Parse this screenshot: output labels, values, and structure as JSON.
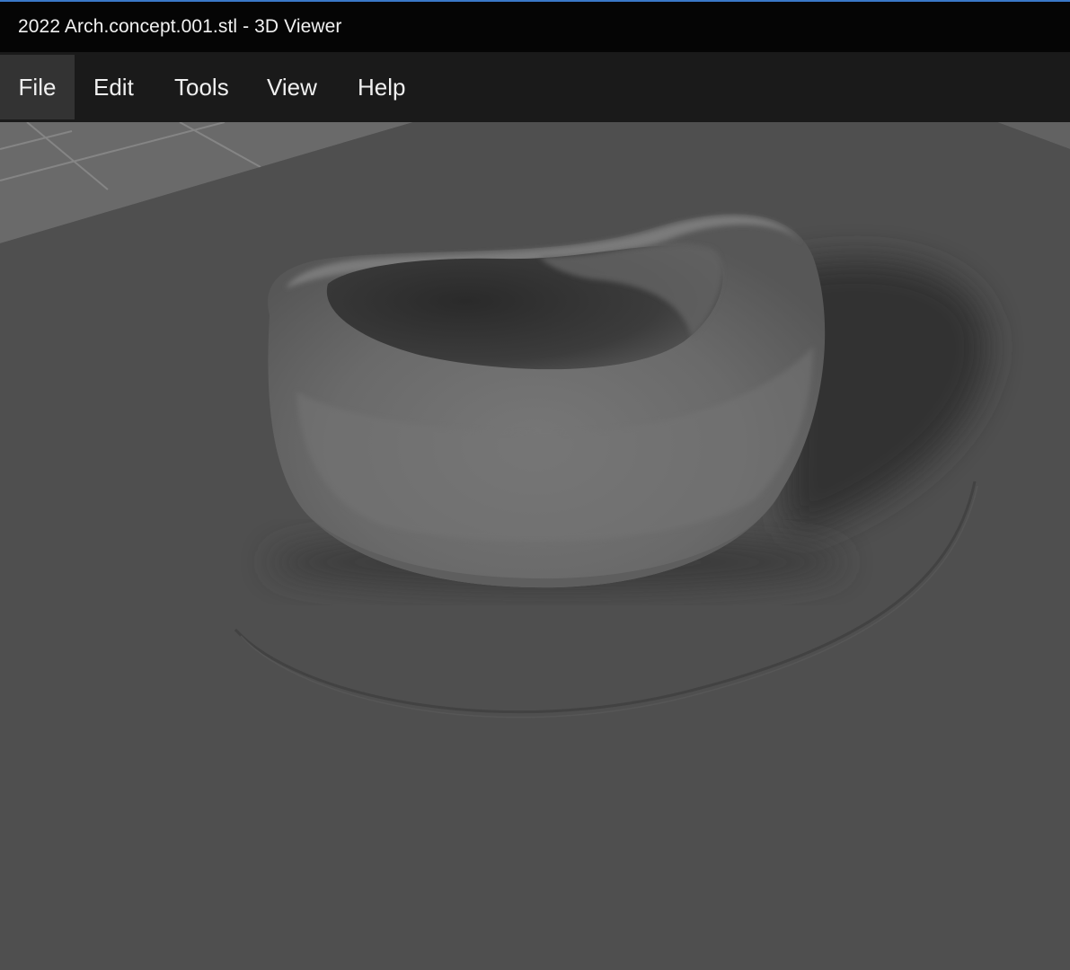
{
  "window": {
    "title": "2022 Arch.concept.001.stl - 3D Viewer"
  },
  "menu": {
    "items": [
      {
        "label": "File",
        "active": true
      },
      {
        "label": "Edit"
      },
      {
        "label": "Tools"
      },
      {
        "label": "View"
      },
      {
        "label": "Help"
      }
    ]
  },
  "viewport": {
    "background_color": "#4c4c4c",
    "plate_color": "#4f4f4f",
    "grid_color": "#7a7a7a",
    "model_color": "#6a6a6a"
  }
}
